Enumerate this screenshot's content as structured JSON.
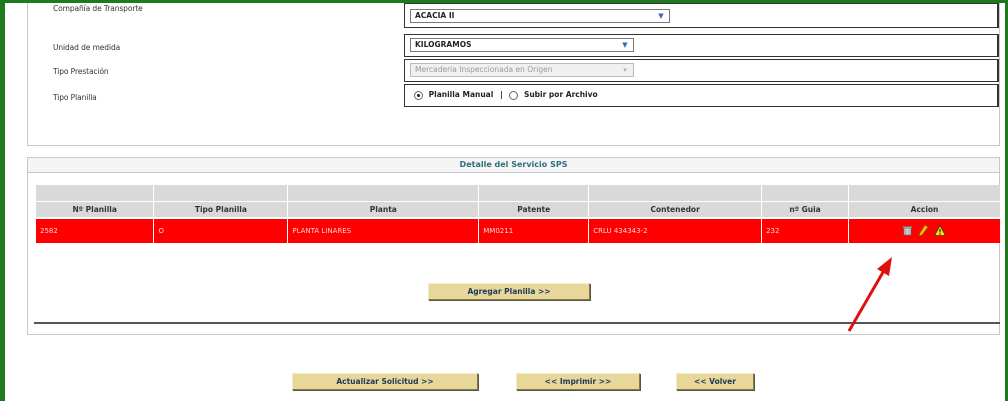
{
  "form": {
    "rows": [
      {
        "label": "Compañía de Transporte",
        "value": "ACACIA II",
        "disabled": false
      },
      {
        "label": "Unidad de medida",
        "value": "KILOGRAMOS",
        "disabled": false
      },
      {
        "label": "Tipo Prestación",
        "value": "Mercaderia Inspeccionada en Origen",
        "disabled": true
      },
      {
        "label": "Tipo Planilla"
      }
    ],
    "radio_manual": "Planilla Manual",
    "radio_sep": "|",
    "radio_file": "Subir por Archivo"
  },
  "detail": {
    "title": "Detalle del Servicio SPS",
    "columns": [
      "Nº Planilla",
      "Tipo Planilla",
      "Planta",
      "Patente",
      "Contenedor",
      "nº Guia",
      "Accion"
    ],
    "row": {
      "planilla": "2582",
      "tipo": "O",
      "planta": "PLANTA LINARES",
      "patente": "MM0211",
      "contenedor": "CRLU 434343-2",
      "guia": "232"
    },
    "add_button": "Agregar Planilla >>"
  },
  "footer": {
    "update_button": "Actualizar Solicitud >>",
    "print_button": "<< Imprimir >>",
    "back_button": "<< Volver"
  },
  "colors": {
    "frame": "#1f7a1f",
    "row_highlight": "#ff0000",
    "button": "#e8d79a",
    "annotation_arrow": "#e01010"
  }
}
